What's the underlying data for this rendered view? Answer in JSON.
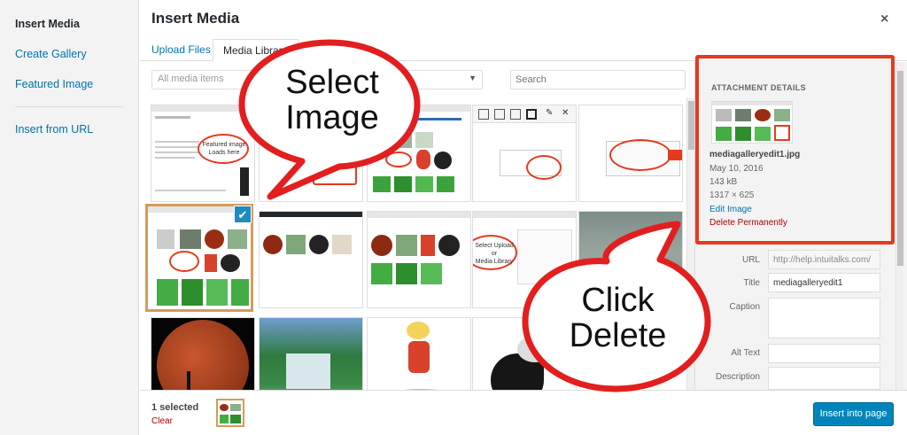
{
  "left_menu": {
    "items": [
      {
        "label": "Insert Media",
        "active": true
      },
      {
        "label": "Create Gallery",
        "active": false
      },
      {
        "label": "Featured Image",
        "active": false
      },
      {
        "label": "Insert from URL",
        "active": false
      }
    ]
  },
  "header": {
    "title": "Insert Media",
    "close": "×"
  },
  "tabs": {
    "upload": "Upload Files",
    "library": "Media Library"
  },
  "toolbar": {
    "filter_value": "All media items",
    "search_placeholder": "Search"
  },
  "attachment": {
    "heading": "ATTACHMENT DETAILS",
    "filename": "mediagalleryedit1.jpg",
    "date": "May 10, 2016",
    "size": "143 kB",
    "dimensions": "1317 × 625",
    "edit_link": "Edit Image",
    "delete_link": "Delete Permanently"
  },
  "fields": {
    "url_label": "URL",
    "url_value": "http://help.intuitalks.com/",
    "title_label": "Title",
    "title_value": "mediagalleryedit1",
    "caption_label": "Caption",
    "alt_label": "Alt Text",
    "description_label": "Description"
  },
  "footer": {
    "selected": "1 selected",
    "clear": "Clear",
    "insert": "Insert into page"
  },
  "callouts": {
    "select_line1": "Select",
    "select_line2": "Image",
    "delete_line1": "Click",
    "delete_line2": "Delete"
  },
  "thumbs": {
    "featured_line1": "Featured image",
    "featured_line2": "Loads here",
    "upload_line1": "Select Upload or",
    "upload_line2": "Media Library"
  },
  "colors": {
    "accent": "#0073aa",
    "callout_border": "#e53a1e",
    "selected_border": "#d59b5c",
    "danger": "#aa0000"
  },
  "check_icon": "✔"
}
